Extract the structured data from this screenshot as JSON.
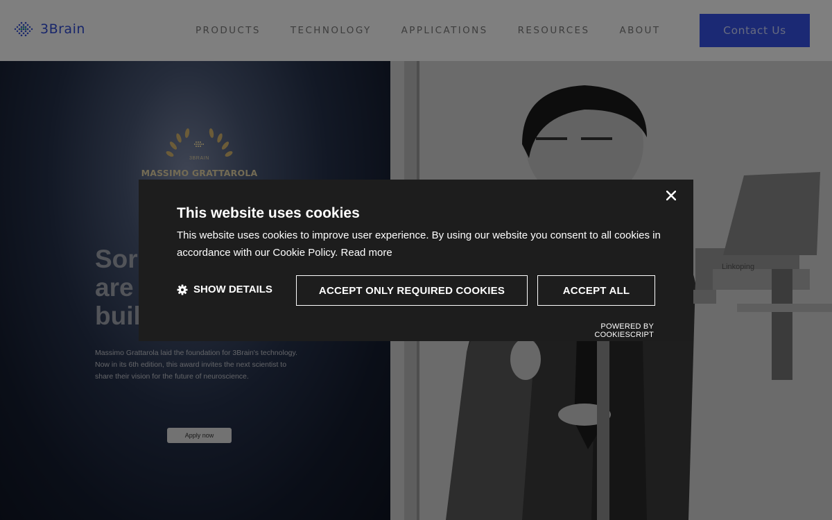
{
  "header": {
    "logo_text": "3Brain",
    "nav": [
      "PRODUCTS",
      "TECHNOLOGY",
      "APPLICATIONS",
      "RESOURCES",
      "ABOUT"
    ],
    "contact_label": "Contact Us",
    "accent_color": "#3652e8"
  },
  "hero": {
    "award_brand": "3BRAIN",
    "award_name": "MASSIMO GRATTAROLA",
    "heading_lines": [
      "Sor",
      "are",
      "buil"
    ],
    "body": "Massimo Grattarola laid the foundation for 3Brain's technology. Now in its 6th edition, this award invites the next scientist to share their vision for the future of neuroscience.",
    "apply_label": "Apply now",
    "podium_label": "Linkoping"
  },
  "cookie": {
    "title": "This website uses cookies",
    "text": "This website uses cookies to improve user experience. By using our website you consent to all cookies in accordance with our Cookie Policy.",
    "read_more": "Read more",
    "show_details": "SHOW DETAILS",
    "accept_required": "ACCEPT ONLY REQUIRED COOKIES",
    "accept_all": "ACCEPT ALL",
    "powered_by": "POWERED BY COOKIESCRIPT",
    "close_icon": "close-icon",
    "gear_icon": "gear-icon"
  }
}
